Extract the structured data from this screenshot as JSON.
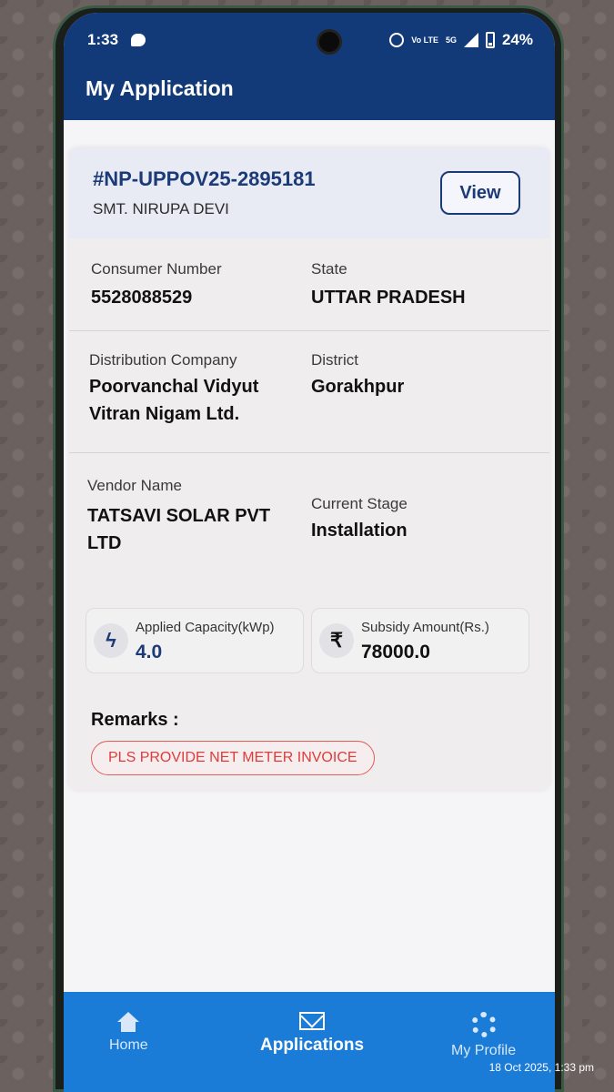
{
  "status": {
    "time": "1:33",
    "network": "5G",
    "volte": "Vo LTE",
    "battery": "24%"
  },
  "header": {
    "title": "My Application"
  },
  "application": {
    "id": "#NP-UPPOV25-2895181",
    "applicant": "SMT. NIRUPA DEVI",
    "view_label": "View"
  },
  "details": {
    "consumer_number": {
      "label": "Consumer Number",
      "value": "5528088529"
    },
    "state": {
      "label": "State",
      "value": "UTTAR PRADESH"
    },
    "distribution_company": {
      "label": "Distribution Company",
      "value": "Poorvanchal Vidyut Vitran Nigam Ltd."
    },
    "district": {
      "label": "District",
      "value": "Gorakhpur"
    },
    "vendor_name": {
      "label": "Vendor Name",
      "value": "TATSAVI SOLAR PVT LTD"
    },
    "current_stage": {
      "label": "Current Stage",
      "value": "Installation"
    }
  },
  "stats": {
    "capacity": {
      "label": "Applied Capacity(kWp)",
      "value": "4.0",
      "icon": "lightning-icon"
    },
    "subsidy": {
      "label": "Subsidy Amount(Rs.)",
      "value": "78000.0",
      "icon": "rupee-icon",
      "glyph": "₹"
    }
  },
  "remarks": {
    "title": "Remarks :",
    "items": [
      "PLS PROVIDE NET METER INVOICE"
    ]
  },
  "nav": {
    "items": [
      {
        "label": "Home",
        "icon": "home-icon"
      },
      {
        "label": "Applications",
        "icon": "mail-icon"
      },
      {
        "label": "My Profile",
        "icon": "gear-icon"
      }
    ]
  },
  "photo_timestamp": "18 Oct 2025, 1:33 pm",
  "colors": {
    "primary": "#123a78",
    "accent": "#1b7cd8",
    "remark": "#e03b3b"
  }
}
